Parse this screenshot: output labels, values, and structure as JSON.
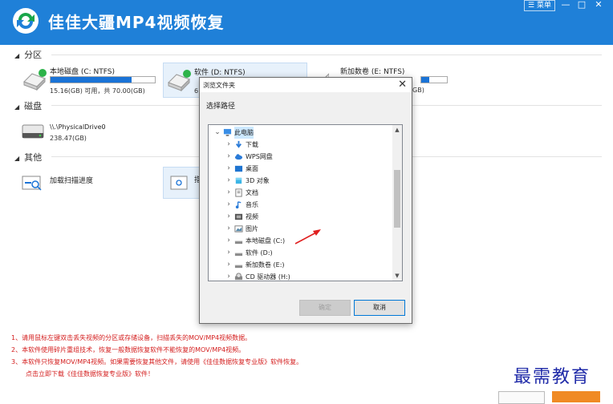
{
  "app": {
    "title": "佳佳大疆MP4视频恢复",
    "menu_label": "菜单"
  },
  "sections": {
    "partitions": "分区",
    "disks": "磁盘",
    "others": "其他"
  },
  "drives": [
    {
      "name": "本地磁盘 (C: NTFS)",
      "info": "15.16(GB) 可用，共 70.00(GB)",
      "used_fraction": 0.78
    },
    {
      "name": "软件 (D: NTFS)",
      "info": "6",
      "used_fraction": 0.5
    },
    {
      "name": "新加数卷 (E: NTFS)",
      "info": "GB)",
      "used_fraction": 0.3
    }
  ],
  "disk": {
    "name": "\\\\.\\PhysicalDrive0",
    "info": "238.47(GB)"
  },
  "other": {
    "load_label": "加载扫描进度",
    "partial_label": "指"
  },
  "dialog": {
    "title": "浏览文件夹",
    "prompt": "选择路径",
    "ok_label": "确定",
    "cancel_label": "取消",
    "tree": [
      {
        "label": "此电脑",
        "icon": "computer-icon"
      },
      {
        "label": "下载",
        "icon": "download-icon"
      },
      {
        "label": "WPS网盘",
        "icon": "cloud-icon"
      },
      {
        "label": "桌面",
        "icon": "desktop-icon"
      },
      {
        "label": "3D 对象",
        "icon": "cube-icon"
      },
      {
        "label": "文档",
        "icon": "document-icon"
      },
      {
        "label": "音乐",
        "icon": "music-icon"
      },
      {
        "label": "视频",
        "icon": "video-icon"
      },
      {
        "label": "图片",
        "icon": "picture-icon"
      },
      {
        "label": "本地磁盘 (C:)",
        "icon": "drive-icon"
      },
      {
        "label": "软件 (D:)",
        "icon": "drive-icon"
      },
      {
        "label": "新加数卷 (E:)",
        "icon": "drive-icon"
      },
      {
        "label": "CD 驱动器 (H:)",
        "icon": "cd-drive-icon"
      }
    ]
  },
  "notes": [
    "1、请用鼠标左键双击丢失视频的分区或存储设备，扫描丢失的MOV/MP4视频数据。",
    "2、本软件使用碎片重组技术，恢复一般数据恢复软件不能恢复的MOV/MP4视频。",
    "3、本软件只恢复MOV/MP4视频。如果需要恢复其他文件，请使用《佳佳数据恢复专业版》软件恢复。",
    "点击立即下载《佳佳数据恢复专业版》软件！"
  ],
  "watermark": "最需教育",
  "colors": {
    "titlebar": "#1f80d8",
    "note_red": "#d41e1e",
    "progress": "#1a73d6",
    "arrow_red": "#e02020"
  }
}
